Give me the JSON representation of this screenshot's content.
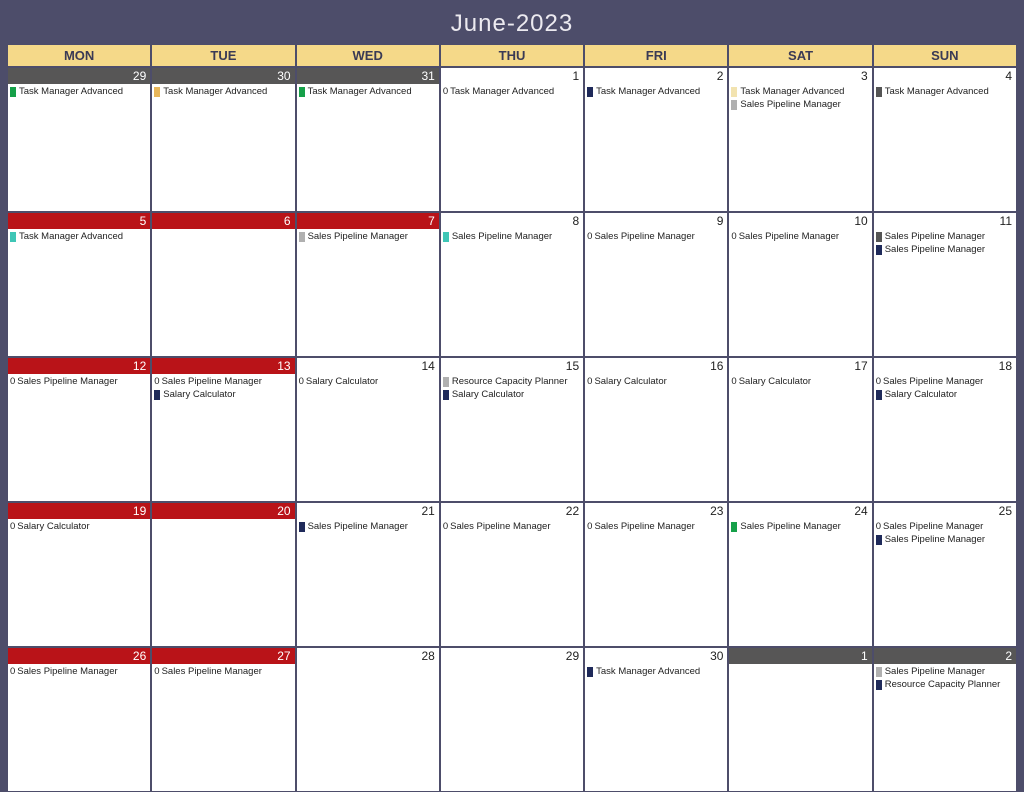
{
  "title": "June-2023",
  "weekdays": [
    "MON",
    "TUE",
    "WED",
    "THU",
    "FRI",
    "SAT",
    "SUN"
  ],
  "labels": {
    "tma": "Task Manager Advanced",
    "spm": "Sales Pipeline Manager",
    "sc": "Salary Calculator",
    "rcp": "Resource Capacity Planner"
  },
  "cells": [
    {
      "day": "29",
      "bar": "gray",
      "events": [
        {
          "c": "green",
          "k": "tma"
        }
      ]
    },
    {
      "day": "30",
      "bar": "gray",
      "events": [
        {
          "c": "orange",
          "k": "tma"
        }
      ]
    },
    {
      "day": "31",
      "bar": "gray",
      "events": [
        {
          "c": "green",
          "k": "tma"
        }
      ]
    },
    {
      "day": "1",
      "bar": "white",
      "events": [
        {
          "z": 1,
          "k": "tma"
        }
      ]
    },
    {
      "day": "2",
      "bar": "white",
      "events": [
        {
          "c": "navy",
          "k": "tma"
        }
      ]
    },
    {
      "day": "3",
      "bar": "white",
      "events": [
        {
          "c": "cream",
          "k": "tma"
        },
        {
          "c": "lgray",
          "k": "spm"
        }
      ]
    },
    {
      "day": "4",
      "bar": "white",
      "events": [
        {
          "c": "dgray",
          "k": "tma"
        }
      ]
    },
    {
      "day": "5",
      "bar": "red",
      "events": [
        {
          "c": "teal",
          "k": "tma"
        }
      ]
    },
    {
      "day": "6",
      "bar": "red",
      "events": []
    },
    {
      "day": "7",
      "bar": "red",
      "events": [
        {
          "c": "lgray",
          "k": "spm"
        }
      ]
    },
    {
      "day": "8",
      "bar": "white",
      "events": [
        {
          "c": "teal",
          "k": "spm"
        }
      ]
    },
    {
      "day": "9",
      "bar": "white",
      "events": [
        {
          "z": 1,
          "k": "spm"
        }
      ]
    },
    {
      "day": "10",
      "bar": "white",
      "events": [
        {
          "z": 1,
          "k": "spm"
        }
      ]
    },
    {
      "day": "11",
      "bar": "white",
      "events": [
        {
          "c": "dgray",
          "k": "spm"
        },
        {
          "c": "navy",
          "k": "spm"
        }
      ]
    },
    {
      "day": "12",
      "bar": "red",
      "events": [
        {
          "z": 1,
          "k": "spm"
        }
      ]
    },
    {
      "day": "13",
      "bar": "red",
      "events": [
        {
          "z": 1,
          "k": "spm"
        },
        {
          "c": "navy",
          "k": "sc"
        }
      ]
    },
    {
      "day": "14",
      "bar": "white",
      "events": [
        {
          "z": 1,
          "k": "sc"
        }
      ]
    },
    {
      "day": "15",
      "bar": "white",
      "events": [
        {
          "c": "lgray",
          "k": "rcp"
        },
        {
          "c": "navy",
          "k": "sc"
        }
      ]
    },
    {
      "day": "16",
      "bar": "white",
      "events": [
        {
          "z": 1,
          "k": "sc"
        }
      ]
    },
    {
      "day": "17",
      "bar": "white",
      "events": [
        {
          "z": 1,
          "k": "sc"
        }
      ]
    },
    {
      "day": "18",
      "bar": "white",
      "events": [
        {
          "z": 1,
          "k": "spm"
        },
        {
          "c": "navy",
          "k": "sc"
        }
      ]
    },
    {
      "day": "19",
      "bar": "red",
      "events": [
        {
          "z": 1,
          "k": "sc"
        }
      ]
    },
    {
      "day": "20",
      "bar": "red",
      "events": []
    },
    {
      "day": "21",
      "bar": "white",
      "events": [
        {
          "c": "navy",
          "k": "spm"
        }
      ]
    },
    {
      "day": "22",
      "bar": "white",
      "events": [
        {
          "z": 1,
          "k": "spm"
        }
      ]
    },
    {
      "day": "23",
      "bar": "white",
      "events": [
        {
          "z": 1,
          "k": "spm"
        }
      ]
    },
    {
      "day": "24",
      "bar": "white",
      "events": [
        {
          "c": "green",
          "k": "spm"
        }
      ]
    },
    {
      "day": "25",
      "bar": "white",
      "events": [
        {
          "z": 1,
          "k": "spm"
        },
        {
          "c": "navy",
          "k": "spm"
        }
      ]
    },
    {
      "day": "26",
      "bar": "red",
      "events": [
        {
          "z": 1,
          "k": "spm"
        }
      ]
    },
    {
      "day": "27",
      "bar": "red",
      "events": [
        {
          "z": 1,
          "k": "spm"
        }
      ]
    },
    {
      "day": "28",
      "bar": "white",
      "events": []
    },
    {
      "day": "29",
      "bar": "white",
      "events": []
    },
    {
      "day": "30",
      "bar": "white",
      "events": [
        {
          "c": "navy",
          "k": "tma"
        }
      ]
    },
    {
      "day": "1",
      "bar": "gray",
      "events": []
    },
    {
      "day": "2",
      "bar": "gray",
      "events": [
        {
          "c": "lgray",
          "k": "spm"
        },
        {
          "c": "navy",
          "k": "rcp"
        }
      ]
    }
  ]
}
